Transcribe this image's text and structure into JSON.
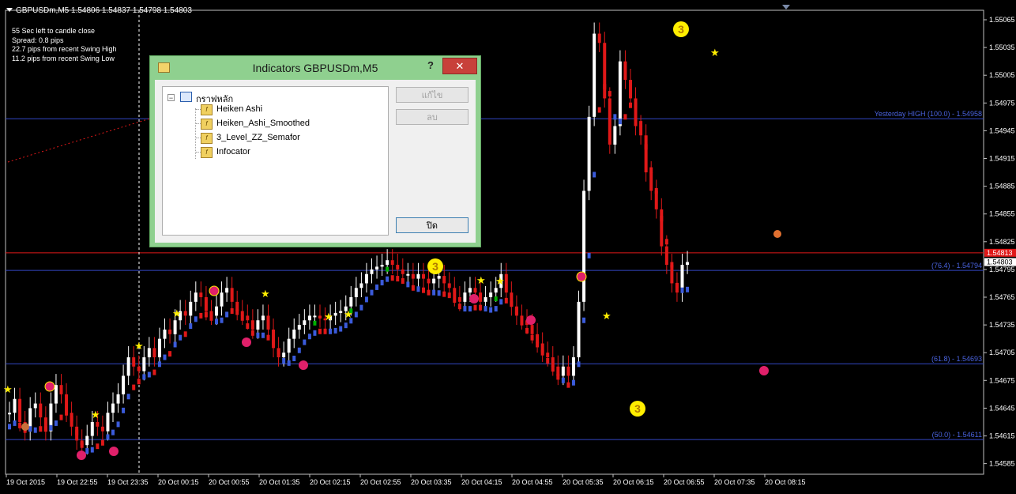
{
  "chart_header": {
    "title": "GBPUSDm,M5  1.54806 1.54837 1.54798 1.54803"
  },
  "info_panel": [
    "55 Sec left to candle close",
    "Spread: 0.8 pips",
    "22.7 pips from recent Swing High",
    "11.2 pips from recent Swing Low"
  ],
  "price_axis": [
    "1.55065",
    "1.55035",
    "1.55005",
    "1.54975",
    "1.54945",
    "1.54915",
    "1.54885",
    "1.54855",
    "1.54825",
    "1.54795",
    "1.54765",
    "1.54735",
    "1.54705",
    "1.54675",
    "1.54645",
    "1.54615",
    "1.54585"
  ],
  "time_axis": [
    "19 Oct 2015",
    "19 Oct 22:55",
    "19 Oct 23:35",
    "20 Oct 00:15",
    "20 Oct 00:55",
    "20 Oct 01:35",
    "20 Oct 02:15",
    "20 Oct 02:55",
    "20 Oct 03:35",
    "20 Oct 04:15",
    "20 Oct 04:55",
    "20 Oct 05:35",
    "20 Oct 06:15",
    "20 Oct 06:55",
    "20 Oct 07:35",
    "20 Oct 08:15"
  ],
  "levels": [
    {
      "label": "Yesterday HIGH (100.0) -  1.54958",
      "price": 1.54958,
      "color": "#3347c4"
    },
    {
      "label": "(76.4) -  1.54794",
      "price": 1.54794,
      "color": "#3347c4"
    },
    {
      "label": "(61.8) -  1.54693",
      "price": 1.54693,
      "color": "#3347c4"
    },
    {
      "label": "(50.0) -  1.54611",
      "price": 1.54611,
      "color": "#3347c4"
    }
  ],
  "bid_line": {
    "price": 1.54813,
    "label": "1.54813",
    "color": "#e01818"
  },
  "current_price": {
    "label": "1.54803",
    "price": 1.54803
  },
  "colors": {
    "bull": "#ffffff",
    "bear": "#e01818",
    "green": "#00b000",
    "blue": "#3b5bdb",
    "grid": "#000000"
  },
  "dialog": {
    "title": "Indicators GBPUSDm,M5",
    "help": "?",
    "close": "✕",
    "root": "กราฟหลัก",
    "items": [
      "Heiken Ashi",
      "Heiken_Ashi_Smoothed",
      "3_Level_ZZ_Semafor",
      "Infocator"
    ],
    "edit_button": "แก้ไข",
    "delete_button": "ลบ",
    "close_button": "ปิด"
  },
  "semafor_labels": [
    "3",
    "3",
    "3"
  ]
}
